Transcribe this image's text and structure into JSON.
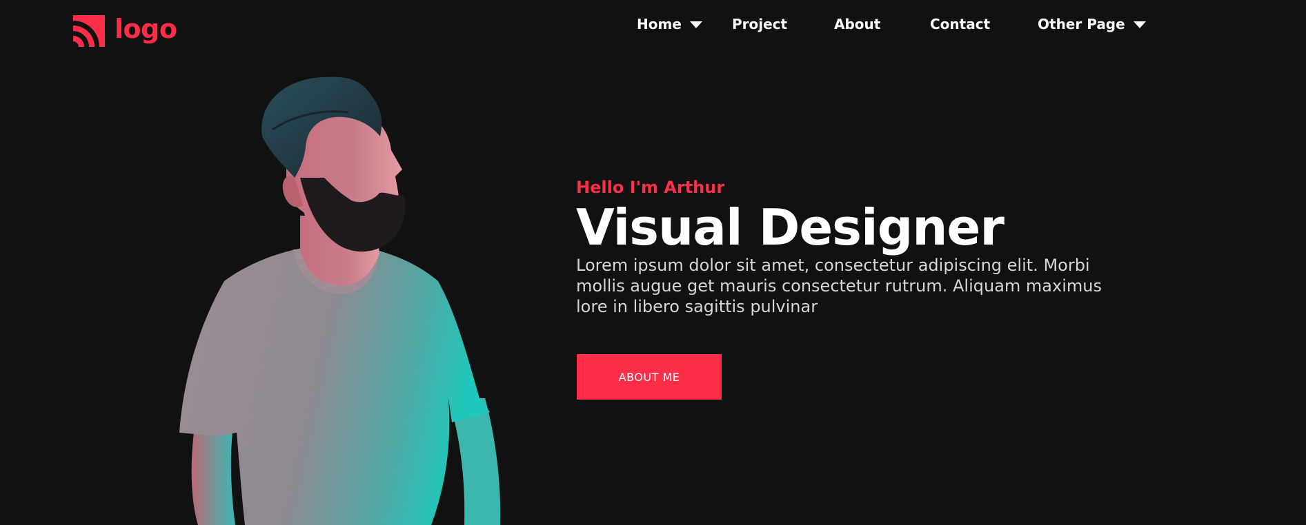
{
  "header": {
    "logo_text": "logo",
    "logo_icon": "rss-arcs-icon",
    "nav": [
      {
        "label": "Home",
        "has_dropdown": true
      },
      {
        "label": "Project",
        "has_dropdown": false
      },
      {
        "label": "About",
        "has_dropdown": false
      },
      {
        "label": "Contact",
        "has_dropdown": false
      },
      {
        "label": "Other Page",
        "has_dropdown": true
      }
    ]
  },
  "hero": {
    "greeting": "Hello I'm Arthur",
    "headline": "Visual Designer",
    "intro": "Lorem ipsum dolor sit amet, consectetur adipiscing elit. Morbi mollis augue get mauris consectetur rutrum. Aliquam maximus lore in libero sagittis pulvinar",
    "button_label": "ABOUT ME"
  },
  "colors": {
    "background": "#111111",
    "accent": "#ff2e48",
    "text": "#ffffff",
    "muted_text": "#d6d6d6"
  }
}
